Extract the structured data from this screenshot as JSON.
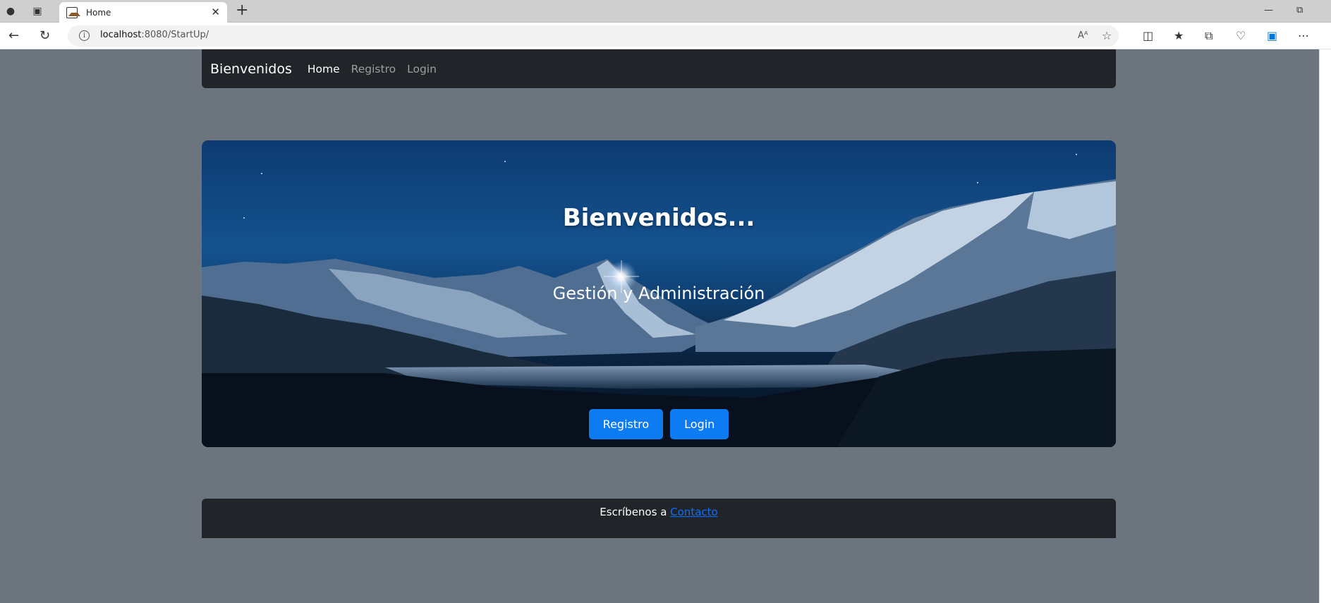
{
  "browser": {
    "tab_title": "Home",
    "url_host": "localhost",
    "url_rest": ":8080/StartUp/",
    "read_aloud_label": "Aᴬ"
  },
  "navbar": {
    "brand": "Bienvenidos",
    "links": [
      {
        "label": "Home",
        "active": true
      },
      {
        "label": "Registro",
        "active": false
      },
      {
        "label": "Login",
        "active": false
      }
    ]
  },
  "hero": {
    "title": "Bienvenidos...",
    "subtitle": "Gestión y Administración",
    "buttons": {
      "registro": "Registro",
      "login": "Login"
    }
  },
  "footer": {
    "text": "Escríbenos a ",
    "link": "Contacto"
  },
  "colors": {
    "page_bg": "#6c757d",
    "navbar_bg": "#212529",
    "button_primary": "#0d7cf2",
    "link": "#0d6efd"
  }
}
